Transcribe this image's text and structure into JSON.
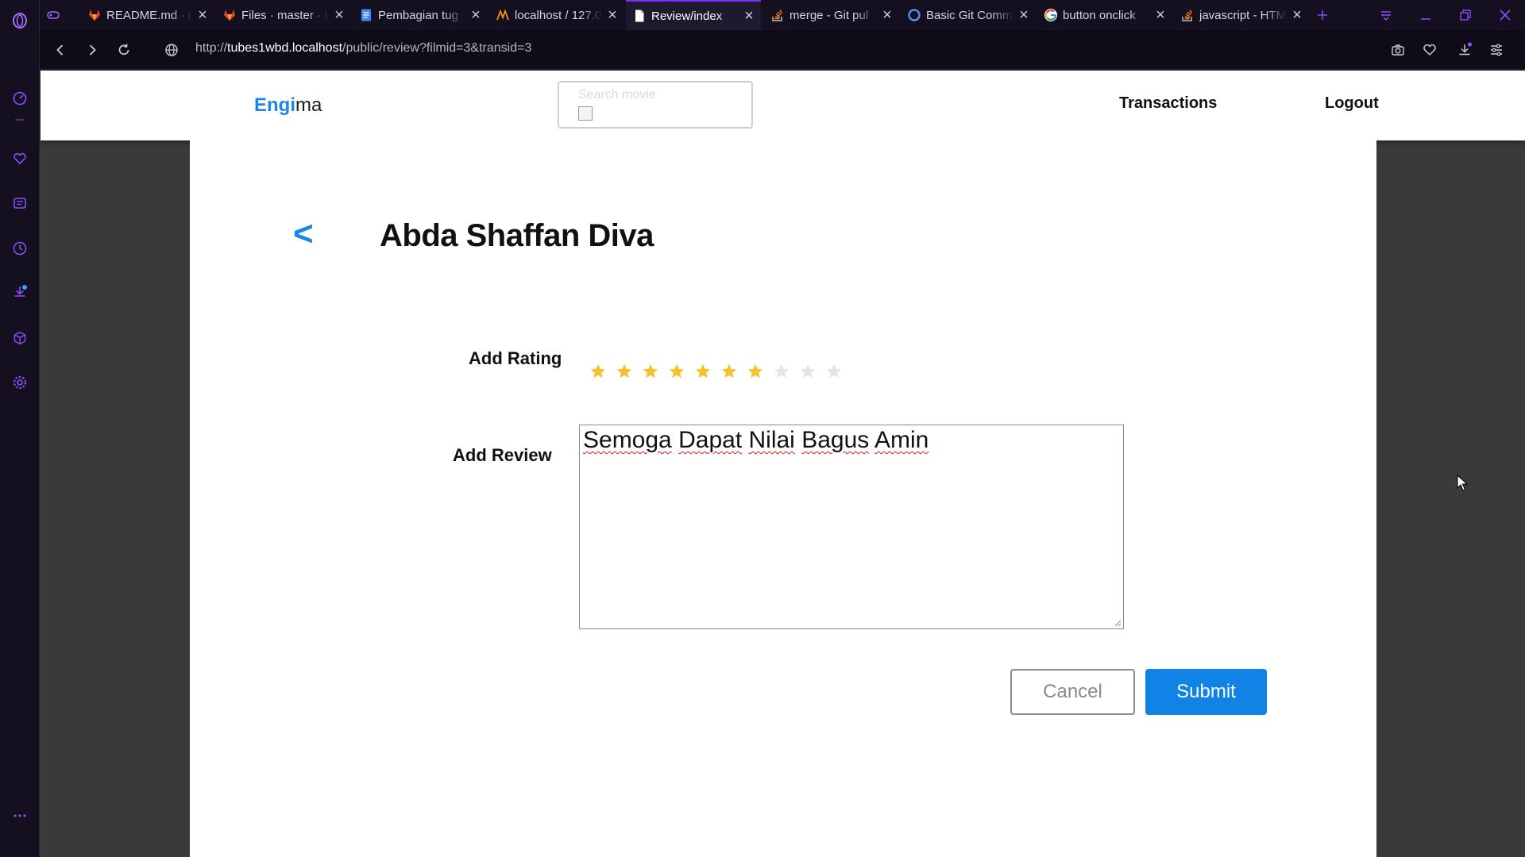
{
  "browser": {
    "tabs": [
      {
        "title": "",
        "icon": "gamepad-icon",
        "active": false
      },
      {
        "title": "README.md · d",
        "icon": "gitlab-icon",
        "active": false
      },
      {
        "title": "Files · master · II",
        "icon": "gitlab-icon",
        "active": false
      },
      {
        "title": "Pembagian tug",
        "icon": "google-docs-icon",
        "active": false
      },
      {
        "title": "localhost / 127.0",
        "icon": "phpmyadmin-icon",
        "active": false
      },
      {
        "title": "Review/index",
        "icon": "page-icon",
        "active": true
      },
      {
        "title": "merge - Git pul",
        "icon": "stackoverflow-icon",
        "active": false
      },
      {
        "title": "Basic Git Comm",
        "icon": "circle-icon",
        "active": false
      },
      {
        "title": "button onclick",
        "icon": "google-icon",
        "active": false
      },
      {
        "title": "javascript - HTM",
        "icon": "stackoverflow-icon",
        "active": false
      }
    ],
    "url_prefix": "http://",
    "url_host": "tubes1wbd.localhost",
    "url_path": "/public/review?filmid=3&transid=3",
    "accent_color": "#7b2fff"
  },
  "header": {
    "logo_highlight": "Engi",
    "logo_rest": "ma",
    "search_placeholder": "Search movie",
    "nav": {
      "transactions": "Transactions",
      "logout": "Logout"
    }
  },
  "main": {
    "back_label": "<",
    "movie_title": "Abda Shaffan Diva",
    "rating_label": "Add Rating",
    "rating": {
      "value": 7,
      "max": 10,
      "filled_color": "#f6c12d",
      "empty_color": "#e8e4e4"
    },
    "review_label": "Add Review",
    "review_text": "Semoga Dapat Nilai Bagus Amin",
    "cancel_label": "Cancel",
    "submit_label": "Submit",
    "brand_color": "#1283e6"
  }
}
